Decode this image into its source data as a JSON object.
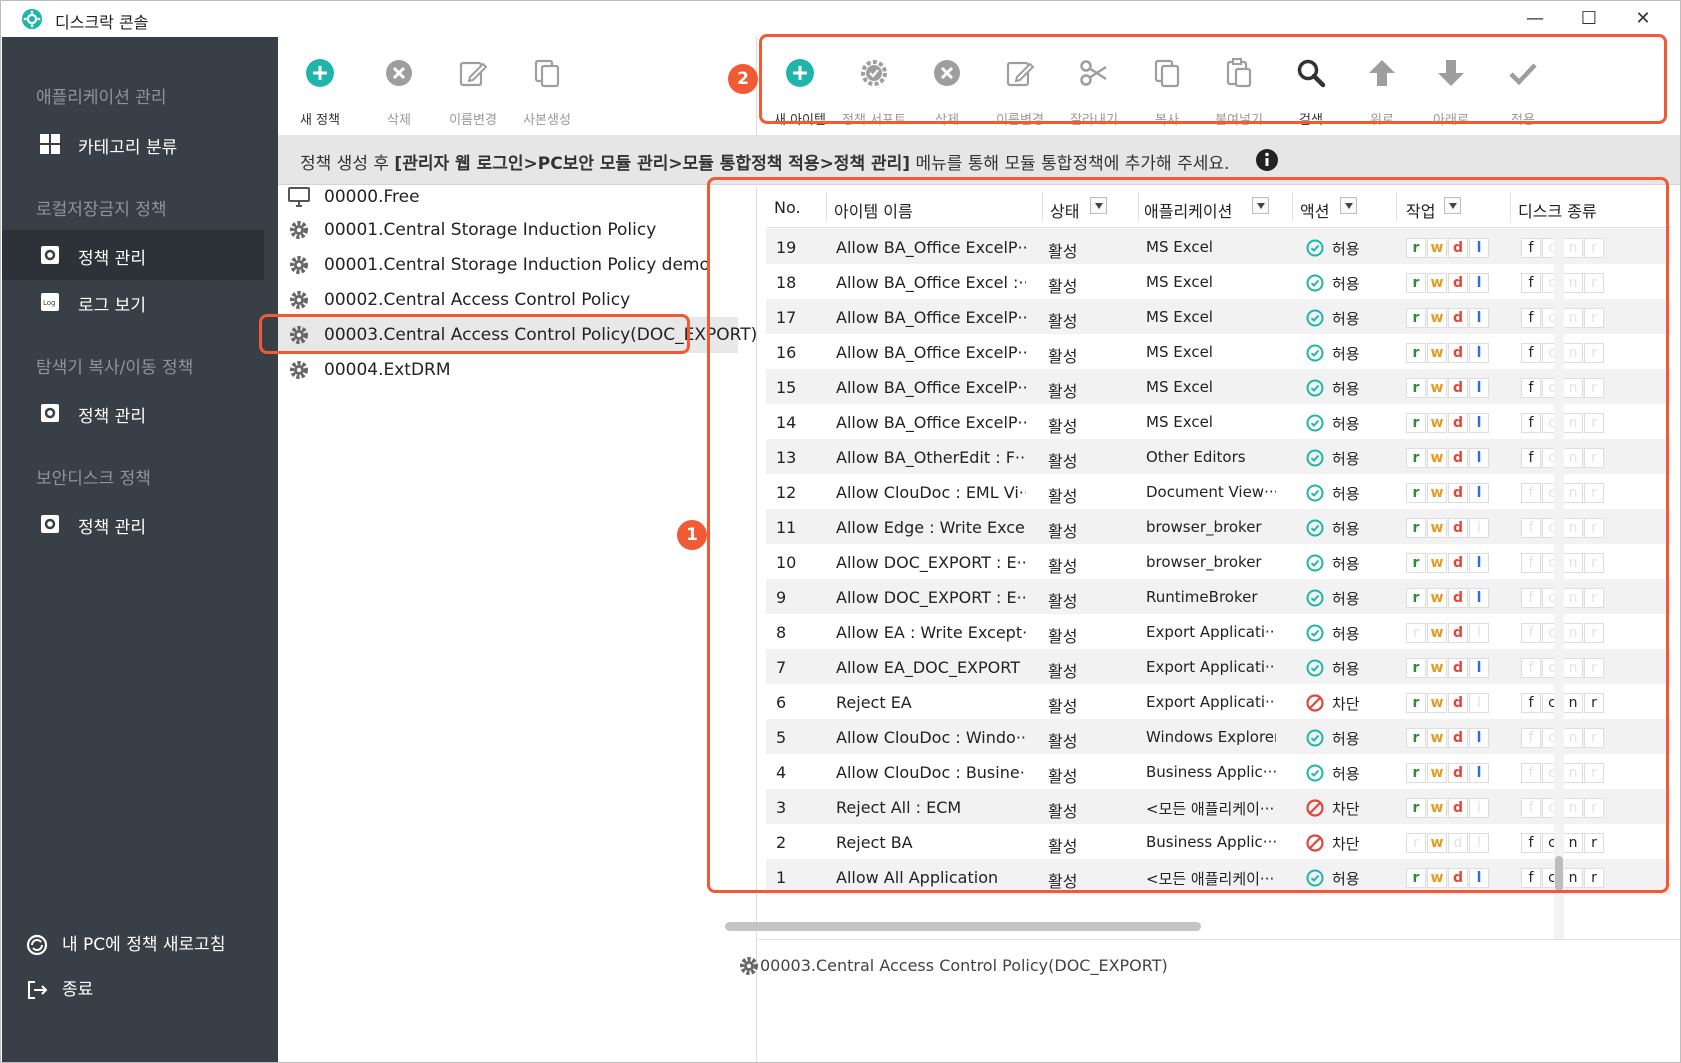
{
  "app": {
    "title": "디스크락 콘솔"
  },
  "sidebar": {
    "groups": [
      {
        "title": "애플리케이션 관리"
      },
      {
        "title": "로컬저장금지 정책"
      },
      {
        "title": "탐색기 복사/이동 정책"
      },
      {
        "title": "보안디스크 정책"
      }
    ],
    "items": [
      {
        "label": "카테고리 분류",
        "icon": "grid-icon"
      },
      {
        "label": "정책 관리",
        "icon": "policy-gear-icon"
      },
      {
        "label": "로그 보기",
        "icon": "log-icon"
      },
      {
        "label": "정책 관리",
        "icon": "policy-gear-icon"
      },
      {
        "label": "정책 관리",
        "icon": "policy-gear-icon"
      }
    ],
    "refresh_label": "내 PC에 정책 새로고침",
    "exit_label": "종료"
  },
  "toolbar_left": [
    {
      "label": "새 정책",
      "icon": "add-circle-icon"
    },
    {
      "label": "삭제",
      "icon": "delete-circle-icon"
    },
    {
      "label": "이름변경",
      "icon": "rename-icon"
    },
    {
      "label": "사본생성",
      "icon": "duplicate-icon"
    }
  ],
  "toolbar_right": [
    {
      "label": "새 아이템",
      "icon": "add-circle-icon"
    },
    {
      "label": "정책 서포트",
      "icon": "gear-check-icon"
    },
    {
      "label": "삭제",
      "icon": "delete-circle-icon"
    },
    {
      "label": "이름변경",
      "icon": "rename-icon"
    },
    {
      "label": "잘라내기",
      "icon": "scissors-icon"
    },
    {
      "label": "복사",
      "icon": "copy-icon"
    },
    {
      "label": "붙여넣기",
      "icon": "paste-icon"
    },
    {
      "label": "검색",
      "icon": "search-icon"
    },
    {
      "label": "위로",
      "icon": "arrow-up-icon"
    },
    {
      "label": "아래로",
      "icon": "arrow-down-icon"
    },
    {
      "label": "적용",
      "icon": "check-icon"
    }
  ],
  "infobar": {
    "prefix": "정책 생성 후",
    "path": "[관리자 웹 로그인>PC보안 모듈 관리>모듈 통합정책 적용>정책 관리]",
    "suffix": "메뉴를 통해 모듈 통합정책에 추가해 주세요."
  },
  "policies": [
    {
      "label": "00000.Free",
      "icon": "monitor-icon"
    },
    {
      "label": "00001.Central Storage Induction Policy",
      "icon": "gear-icon"
    },
    {
      "label": "00001.Central Storage Induction Policy demo",
      "icon": "gear-icon"
    },
    {
      "label": "00002.Central Access Control Policy",
      "icon": "gear-icon"
    },
    {
      "label": "00003.Central Access Control Policy(DOC_EXPORT)",
      "icon": "gear-icon"
    },
    {
      "label": "00004.ExtDRM",
      "icon": "gear-icon"
    }
  ],
  "selected_policy_index": 4,
  "grid": {
    "headers": {
      "no": "No.",
      "name": "아이템 이름",
      "status": "상태",
      "app": "애플리케이션",
      "action": "액션",
      "task": "작업",
      "disk": "디스크 종류"
    },
    "rows": [
      {
        "no": "19",
        "name": "Allow BA_Office ExcelP···",
        "status": "활성",
        "app": "MS Excel",
        "action": "허용",
        "allow": true,
        "perm": [
          1,
          1,
          1,
          1
        ],
        "disk": [
          1,
          0,
          0,
          0
        ]
      },
      {
        "no": "18",
        "name": "Allow BA_Office Excel :···",
        "status": "활성",
        "app": "MS Excel",
        "action": "허용",
        "allow": true,
        "perm": [
          1,
          1,
          1,
          1
        ],
        "disk": [
          1,
          0,
          0,
          0
        ]
      },
      {
        "no": "17",
        "name": "Allow BA_Office ExcelP···",
        "status": "활성",
        "app": "MS Excel",
        "action": "허용",
        "allow": true,
        "perm": [
          1,
          1,
          1,
          1
        ],
        "disk": [
          1,
          0,
          0,
          0
        ]
      },
      {
        "no": "16",
        "name": "Allow BA_Office ExcelP···",
        "status": "활성",
        "app": "MS Excel",
        "action": "허용",
        "allow": true,
        "perm": [
          1,
          1,
          1,
          1
        ],
        "disk": [
          1,
          0,
          0,
          0
        ]
      },
      {
        "no": "15",
        "name": "Allow BA_Office ExcelP···",
        "status": "활성",
        "app": "MS Excel",
        "action": "허용",
        "allow": true,
        "perm": [
          1,
          1,
          1,
          1
        ],
        "disk": [
          1,
          0,
          0,
          0
        ]
      },
      {
        "no": "14",
        "name": "Allow BA_Office ExcelP···",
        "status": "활성",
        "app": "MS Excel",
        "action": "허용",
        "allow": true,
        "perm": [
          1,
          1,
          1,
          1
        ],
        "disk": [
          1,
          0,
          0,
          0
        ]
      },
      {
        "no": "13",
        "name": "Allow BA_OtherEdit : F···",
        "status": "활성",
        "app": "Other Editors",
        "action": "허용",
        "allow": true,
        "perm": [
          1,
          1,
          1,
          1
        ],
        "disk": [
          1,
          0,
          0,
          0
        ]
      },
      {
        "no": "12",
        "name": "Allow ClouDoc : EML Vi···",
        "status": "활성",
        "app": "Document View···",
        "action": "허용",
        "allow": true,
        "perm": [
          1,
          1,
          1,
          1
        ],
        "disk": [
          0,
          0,
          0,
          0
        ]
      },
      {
        "no": "11",
        "name": "Allow Edge : Write Exce···",
        "status": "활성",
        "app": "browser_broker",
        "action": "허용",
        "allow": true,
        "perm": [
          1,
          1,
          1,
          0
        ],
        "disk": [
          0,
          0,
          0,
          0
        ]
      },
      {
        "no": "10",
        "name": "Allow DOC_EXPORT : E···",
        "status": "활성",
        "app": "browser_broker",
        "action": "허용",
        "allow": true,
        "perm": [
          1,
          1,
          1,
          1
        ],
        "disk": [
          0,
          0,
          0,
          0
        ]
      },
      {
        "no": "9",
        "name": "Allow DOC_EXPORT : E···",
        "status": "활성",
        "app": "RuntimeBroker",
        "action": "허용",
        "allow": true,
        "perm": [
          1,
          1,
          1,
          1
        ],
        "disk": [
          0,
          0,
          0,
          0
        ]
      },
      {
        "no": "8",
        "name": "Allow EA : Write Except···",
        "status": "활성",
        "app": "Export Applicati···",
        "action": "허용",
        "allow": true,
        "perm": [
          0,
          1,
          1,
          0
        ],
        "disk": [
          0,
          0,
          0,
          0
        ]
      },
      {
        "no": "7",
        "name": "Allow EA_DOC_EXPORT",
        "status": "활성",
        "app": "Export Applicati···",
        "action": "허용",
        "allow": true,
        "perm": [
          1,
          1,
          1,
          1
        ],
        "disk": [
          0,
          0,
          0,
          0
        ]
      },
      {
        "no": "6",
        "name": "Reject EA",
        "status": "활성",
        "app": "Export Applicati···",
        "action": "차단",
        "allow": false,
        "perm": [
          1,
          1,
          1,
          0
        ],
        "disk": [
          1,
          1,
          1,
          1
        ]
      },
      {
        "no": "5",
        "name": "Allow ClouDoc : Windo···",
        "status": "활성",
        "app": "Windows Explorer",
        "action": "허용",
        "allow": true,
        "perm": [
          1,
          1,
          1,
          1
        ],
        "disk": [
          0,
          0,
          0,
          0
        ]
      },
      {
        "no": "4",
        "name": "Allow ClouDoc : Busine···",
        "status": "활성",
        "app": "Business Applic···",
        "action": "허용",
        "allow": true,
        "perm": [
          1,
          1,
          1,
          1
        ],
        "disk": [
          0,
          0,
          0,
          0
        ]
      },
      {
        "no": "3",
        "name": "Reject All : ECM",
        "status": "활성",
        "app": "<모든 애플리케이···",
        "action": "차단",
        "allow": false,
        "perm": [
          1,
          1,
          1,
          0
        ],
        "disk": [
          0,
          0,
          0,
          0
        ]
      },
      {
        "no": "2",
        "name": "Reject BA",
        "status": "활성",
        "app": "Business Applic···",
        "action": "차단",
        "allow": false,
        "perm": [
          0,
          1,
          0,
          0
        ],
        "disk": [
          1,
          1,
          1,
          1
        ]
      },
      {
        "no": "1",
        "name": "Allow All Application",
        "status": "활성",
        "app": "<모든 애플리케이···",
        "action": "허용",
        "allow": true,
        "perm": [
          1,
          1,
          1,
          1
        ],
        "disk": [
          1,
          1,
          1,
          1
        ]
      }
    ]
  },
  "perm_letters": [
    "r",
    "w",
    "d",
    "l"
  ],
  "disk_letters": [
    "f",
    "c",
    "n",
    "r"
  ],
  "statusbar": {
    "policy": "00003.Central Access Control Policy(DOC_EXPORT)"
  },
  "callouts": [
    "1",
    "2"
  ],
  "colors": {
    "accent": "#f05a34",
    "teal": "#1fb5ad",
    "sidebar": "#383f47",
    "allow": "#1fb5ad",
    "block": "#e0463a"
  }
}
